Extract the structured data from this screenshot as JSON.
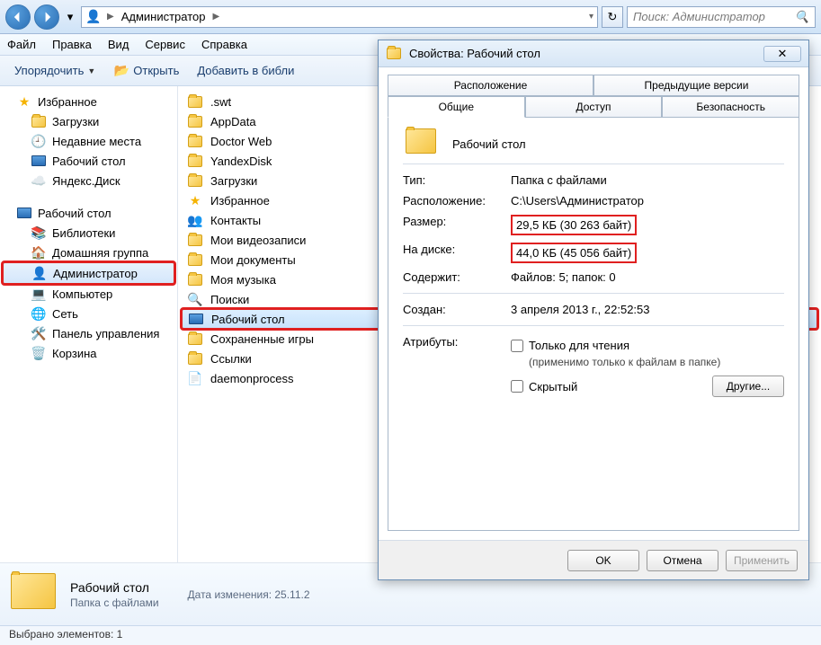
{
  "nav": {
    "breadcrumb_root": "Администратор",
    "search_placeholder": "Поиск: Администратор"
  },
  "menu": {
    "file": "Файл",
    "edit": "Правка",
    "view": "Вид",
    "service": "Сервис",
    "help": "Справка"
  },
  "toolbar": {
    "organize": "Упорядочить",
    "open": "Открыть",
    "addlib": "Добавить в библи"
  },
  "tree": {
    "favorites": "Избранное",
    "downloads": "Загрузки",
    "recent": "Недавние места",
    "desktop": "Рабочий стол",
    "yandex": "Яндекс.Диск",
    "desktop2": "Рабочий стол",
    "libs": "Библиотеки",
    "homegroup": "Домашняя группа",
    "admin": "Администратор",
    "computer": "Компьютер",
    "network": "Сеть",
    "cpanel": "Панель управления",
    "recycle": "Корзина"
  },
  "files": [
    ".swt",
    "AppData",
    "Doctor Web",
    "YandexDisk",
    "Загрузки",
    "Избранное",
    "Контакты",
    "Мои видеозаписи",
    "Мои документы",
    "Моя музыка",
    "Поиски",
    "Рабочий стол",
    "Сохраненные игры",
    "Ссылки",
    "daemonprocess"
  ],
  "details": {
    "name": "Рабочий стол",
    "type": "Папка с файлами",
    "modified_label": "Дата изменения:",
    "modified": "25.11.2"
  },
  "status": {
    "selected_label": "Выбрано элементов:",
    "selected_count": "1"
  },
  "props": {
    "title": "Свойства: Рабочий стол",
    "tabs": {
      "location": "Расположение",
      "prev": "Предыдущие версии",
      "general": "Общие",
      "access": "Доступ",
      "security": "Безопасность"
    },
    "name": "Рабочий стол",
    "rows": {
      "type_l": "Тип:",
      "type_v": "Папка с файлами",
      "loc_l": "Расположение:",
      "loc_v": "C:\\Users\\Администратор",
      "size_l": "Размер:",
      "size_v": "29,5 КБ (30 263 байт)",
      "disk_l": "На диске:",
      "disk_v": "44,0 КБ (45 056 байт)",
      "cont_l": "Содержит:",
      "cont_v": "Файлов: 5; папок: 0",
      "created_l": "Создан:",
      "created_v": "3 апреля 2013 г., 22:52:53",
      "attr_l": "Атрибуты:",
      "readonly": "Только для чтения",
      "readonly_note": "(применимо только к файлам в папке)",
      "hidden": "Скрытый",
      "other_btn": "Другие..."
    },
    "buttons": {
      "ok": "OK",
      "cancel": "Отмена",
      "apply": "Применить"
    }
  }
}
